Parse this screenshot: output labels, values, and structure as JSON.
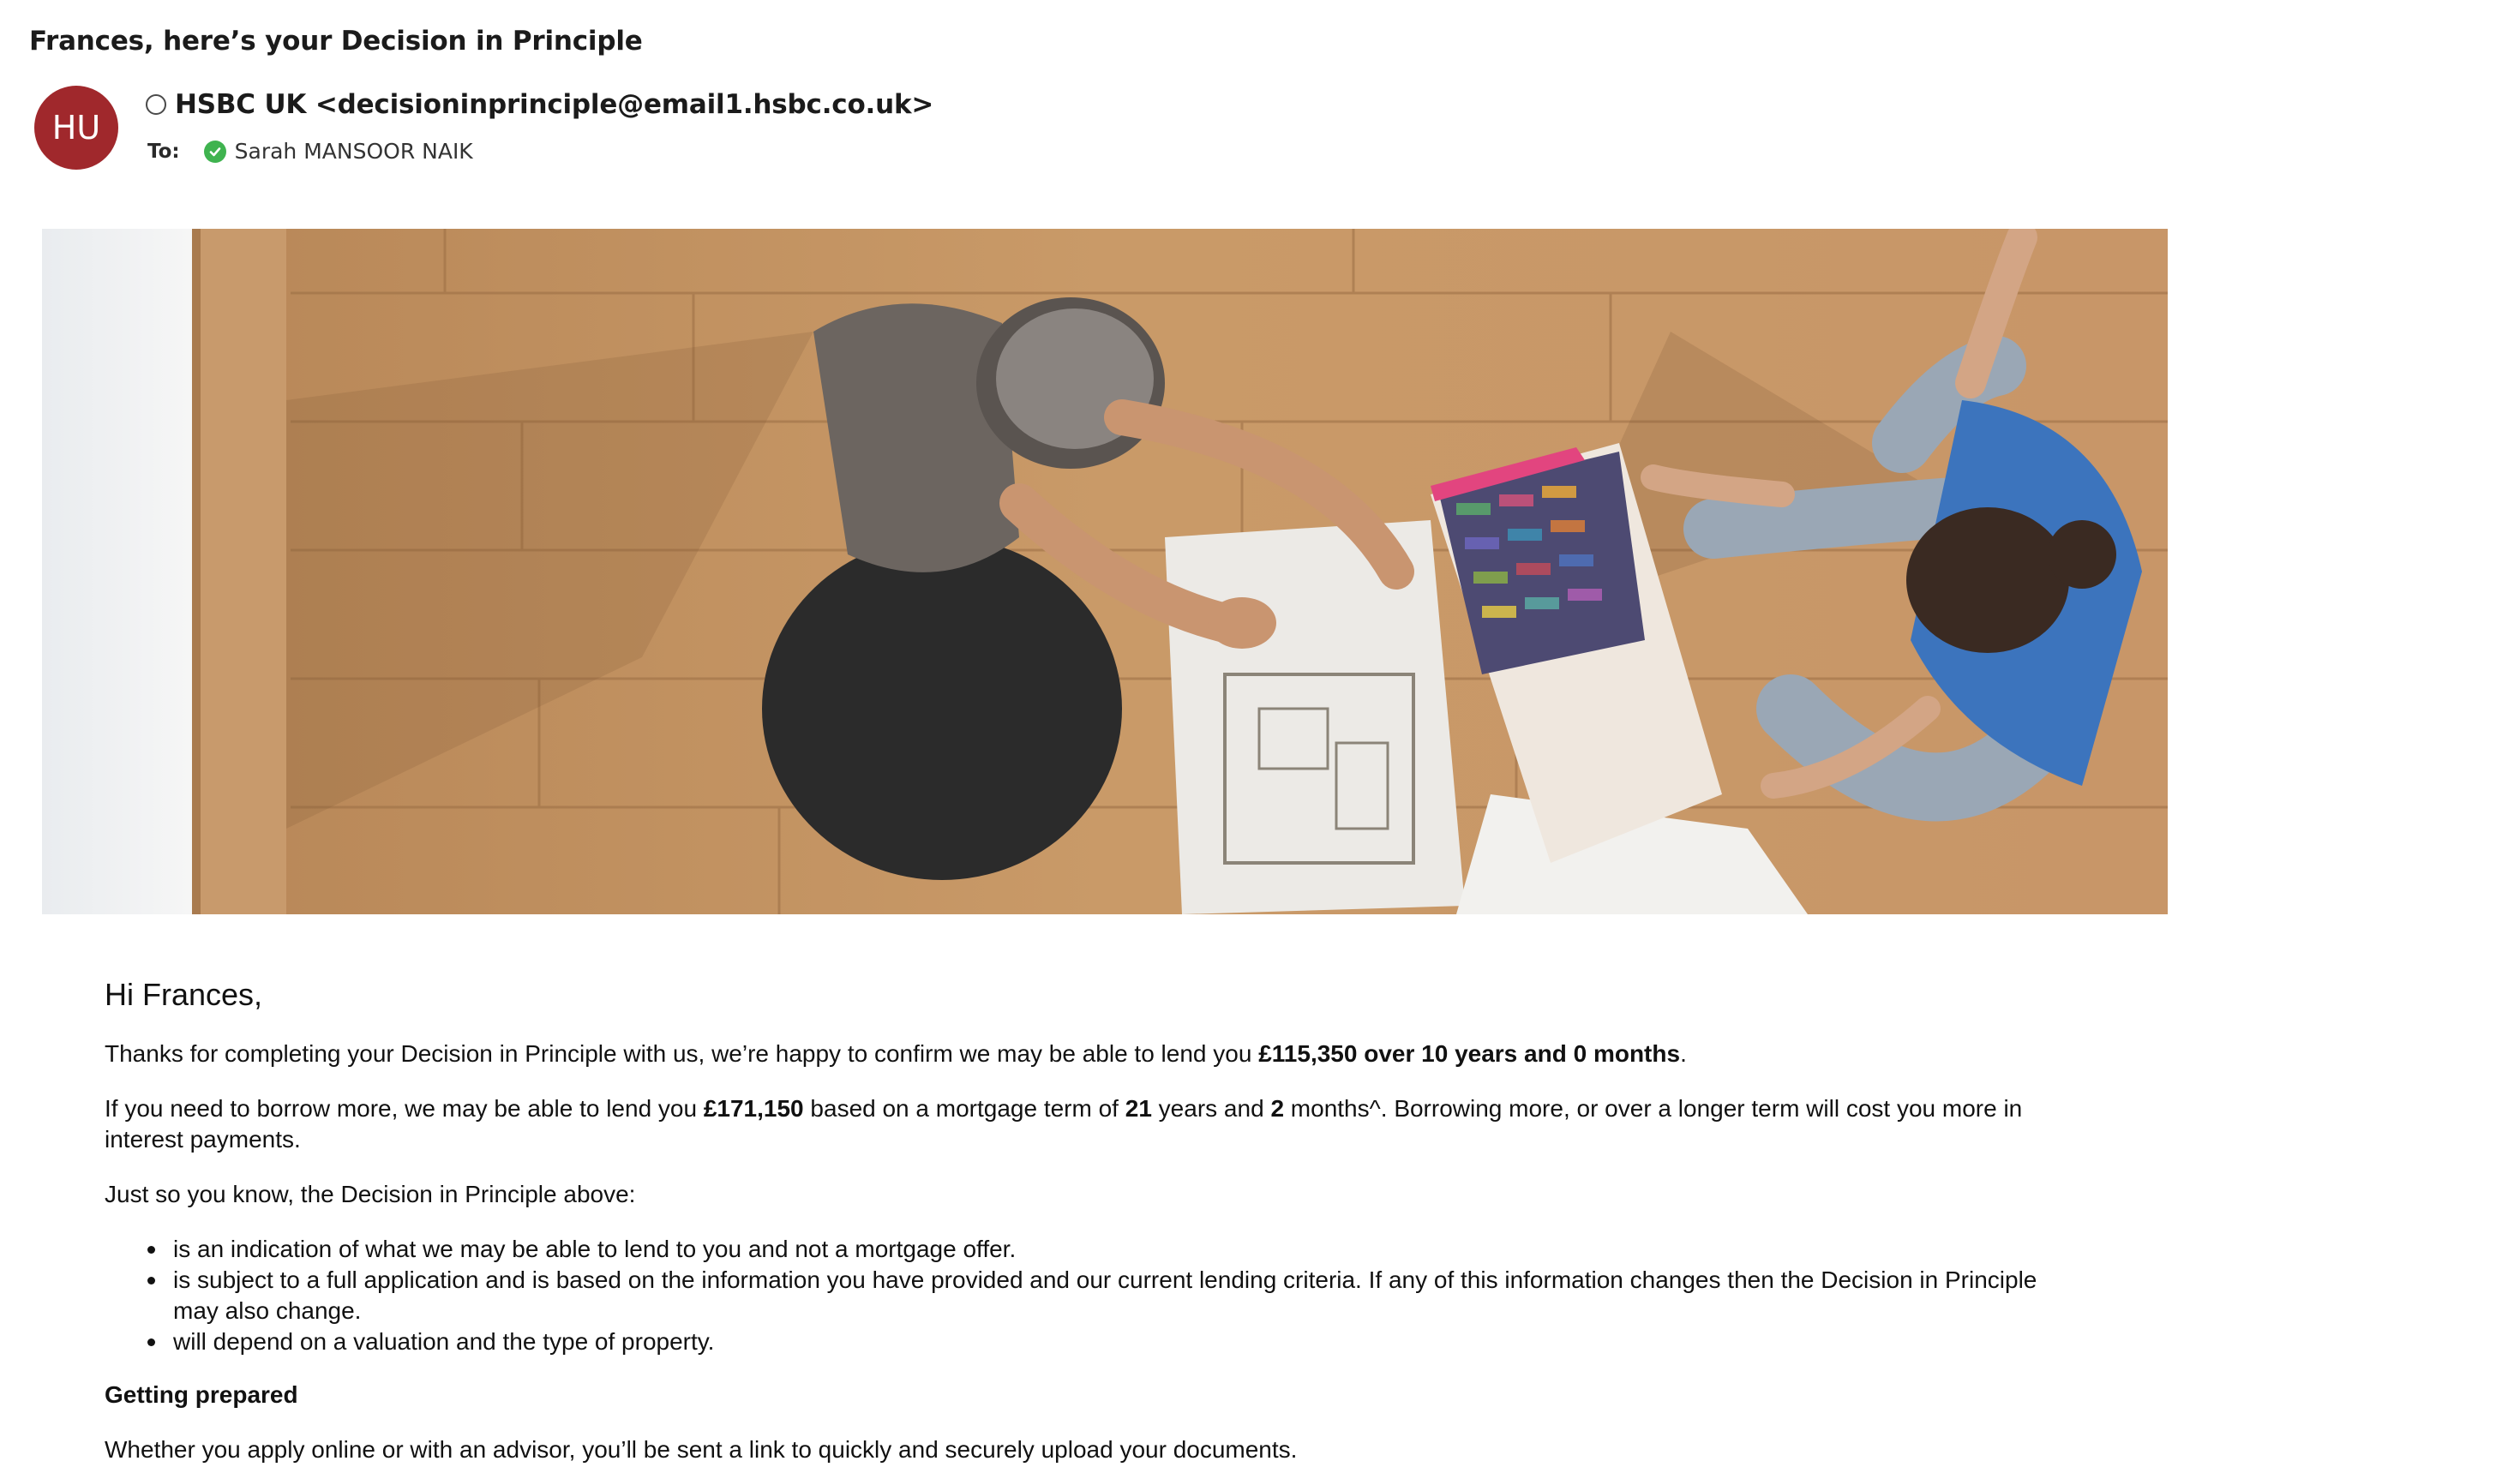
{
  "email": {
    "subject": "Frances, here’s your Decision in Principle",
    "avatar_initials": "HU",
    "avatar_color": "#a0282c",
    "sender": "HSBC UK <decisioninprinciple@email1.hsbc.co.uk>",
    "to_label": "To:",
    "recipient": "Sarah MANSOOR NAIK"
  },
  "hero": {
    "description_icon": "hero-photo"
  },
  "body": {
    "greeting": "Hi Frances,",
    "p1_prefix": "Thanks for completing your Decision in Principle with us, we’re happy to confirm we may be able to lend you ",
    "p1_bold": "£115,350 over 10 years and 0 months",
    "p1_suffix": ".",
    "p2_a": "If you need to borrow more, we may be able to lend you ",
    "p2_amount": "£171,150",
    "p2_b": " based on a mortgage term of ",
    "p2_years": "21",
    "p2_c": " years and ",
    "p2_months": "2",
    "p2_d": " months^. Borrowing more, or over a longer term will cost you more in interest payments.",
    "p3": "Just so you know, the Decision in Principle above:",
    "bullets": [
      "is an indication of what we may be able to lend to you and not a mortgage offer.",
      "is subject to a full application and is based on the information you have provided and our current lending criteria. If any of this information changes then the Decision in Principle may also change.",
      "will depend on a valuation and the type of property."
    ],
    "heading": "Getting prepared",
    "p4": "Whether you apply online or with an advisor, you’ll be sent a link to quickly and securely upload your documents."
  }
}
